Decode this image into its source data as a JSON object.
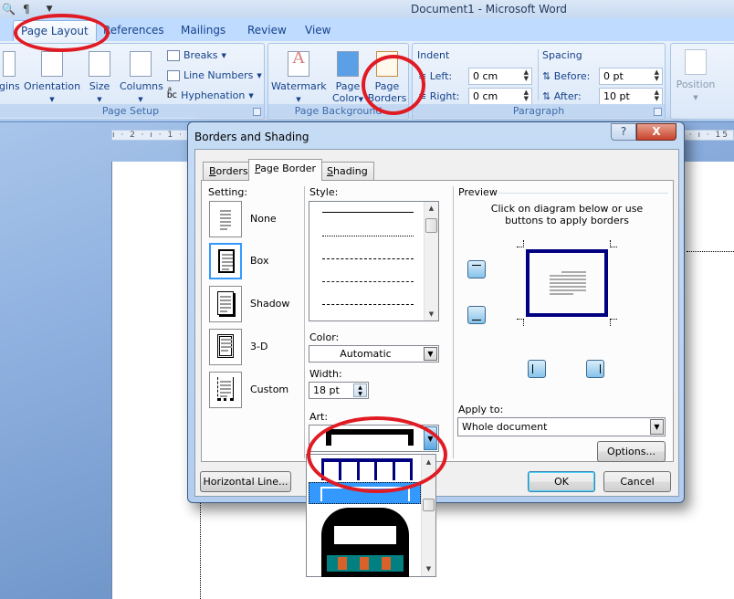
{
  "window": {
    "title": "Document1 - Microsoft Word"
  },
  "ribbon": {
    "tabs": [
      {
        "label": "Page Layout",
        "active": true
      },
      {
        "label": "References"
      },
      {
        "label": "Mailings"
      },
      {
        "label": "Review"
      },
      {
        "label": "View"
      }
    ],
    "groups": {
      "page_setup": {
        "label": "Page Setup",
        "buttons": {
          "margins": "gins",
          "orientation": "Orientation",
          "size": "Size",
          "columns": "Columns",
          "breaks": "Breaks",
          "line_numbers": "Line Numbers",
          "hyphenation": "Hyphenation"
        }
      },
      "page_background": {
        "label": "Page Background",
        "buttons": {
          "watermark": "Watermark",
          "page_color_1": "Page",
          "page_color_2": "Color",
          "page_borders_1": "Page",
          "page_borders_2": "Borders"
        }
      },
      "paragraph": {
        "label": "Paragraph",
        "indent_label": "Indent",
        "left_label": "Left:",
        "left_value": "0 cm",
        "right_label": "Right:",
        "right_value": "0 cm",
        "spacing_label": "Spacing",
        "before_label": "Before:",
        "before_value": "0 pt",
        "after_label": "After:",
        "after_value": "10 pt"
      },
      "arrange": {
        "position": "Position"
      }
    }
  },
  "ruler": {
    "left_ticks": "ı · 2 · ı · 1 · ı",
    "right_ticks": "ı · ı · 15"
  },
  "dialog": {
    "title": "Borders and Shading",
    "help": "?",
    "close": "X",
    "tabs": [
      {
        "label": "Borders",
        "accel": "B"
      },
      {
        "label": "Page Border",
        "accel": "P",
        "active": true
      },
      {
        "label": "Shading",
        "accel": "S"
      }
    ],
    "setting": {
      "label": "Setting:",
      "options": [
        {
          "label": "None"
        },
        {
          "label": "Box",
          "selected": true
        },
        {
          "label": "Shadow"
        },
        {
          "label": "3-D"
        },
        {
          "label": "Custom"
        }
      ]
    },
    "style": {
      "label": "Style:",
      "items": [
        "solid",
        "dotted",
        "dashed-small",
        "dashed-large",
        "dash-dot"
      ]
    },
    "color": {
      "label": "Color:",
      "value": "Automatic"
    },
    "width": {
      "label": "Width:",
      "value": "18 pt"
    },
    "art": {
      "label": "Art:",
      "selected": "black-frame-art",
      "options": [
        "blue-boxes-art",
        "blue-frame-art",
        "ornate-teal-art"
      ]
    },
    "preview": {
      "label": "Preview",
      "hint": "Click on diagram below or use buttons to apply borders",
      "border_color": "#000080"
    },
    "apply_to": {
      "label": "Apply to:",
      "value": "Whole document"
    },
    "buttons": {
      "options": "Options...",
      "horizontal_line": "Horizontal Line...",
      "ok": "OK",
      "cancel": "Cancel"
    }
  },
  "annotations": {
    "highlight_color": "#e01b24"
  }
}
